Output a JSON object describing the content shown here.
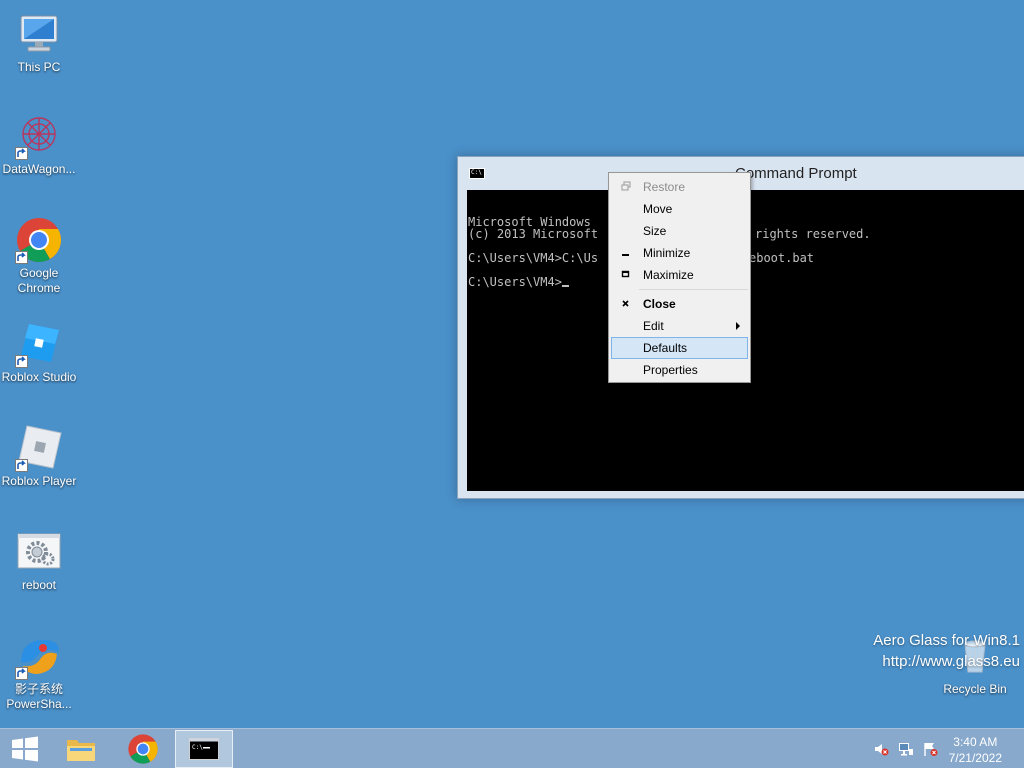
{
  "desktop": {
    "icons": [
      {
        "label": "This PC"
      },
      {
        "label": "DataWagon..."
      },
      {
        "label": "Google Chrome"
      },
      {
        "label": "Roblox Studio"
      },
      {
        "label": "Roblox Player"
      },
      {
        "label": "reboot"
      },
      {
        "label": "影子系统 PowerSha..."
      },
      {
        "label": "Recycle Bin"
      }
    ]
  },
  "window": {
    "title": "Command Prompt",
    "icon_text": "C:\\",
    "console_lines": [
      "Microsoft Windows",
      "(c) 2013 Microsoft",
      "C:\\Users\\VM4>C:\\Us",
      "C:\\Users\\VM4>"
    ],
    "console_right_fragments": [
      "rights reserved.",
      "eboot.bat"
    ]
  },
  "context_menu": {
    "items": [
      {
        "label": "Restore",
        "icon": "restore-icon",
        "disabled": true
      },
      {
        "label": "Move"
      },
      {
        "label": "Size"
      },
      {
        "label": "Minimize",
        "icon": "minimize-icon"
      },
      {
        "label": "Maximize",
        "icon": "maximize-icon"
      },
      {
        "label": "Close",
        "icon": "close-icon",
        "bold": true
      },
      {
        "label": "Edit",
        "submenu": true
      },
      {
        "label": "Defaults",
        "highlighted": true
      },
      {
        "label": "Properties"
      }
    ]
  },
  "watermark": {
    "line1": "Aero Glass for Win8.1",
    "line2": "http://www.glass8.eu"
  },
  "taskbar": {
    "pinned": [
      "start-button",
      "file-explorer",
      "google-chrome",
      "command-prompt"
    ],
    "clock_time": "3:40 AM",
    "clock_date": "7/21/2022"
  },
  "colors": {
    "desktop": "#4a90c9",
    "taskbar": "#88a9cc",
    "menu_highlight": "#d5e6f7"
  }
}
